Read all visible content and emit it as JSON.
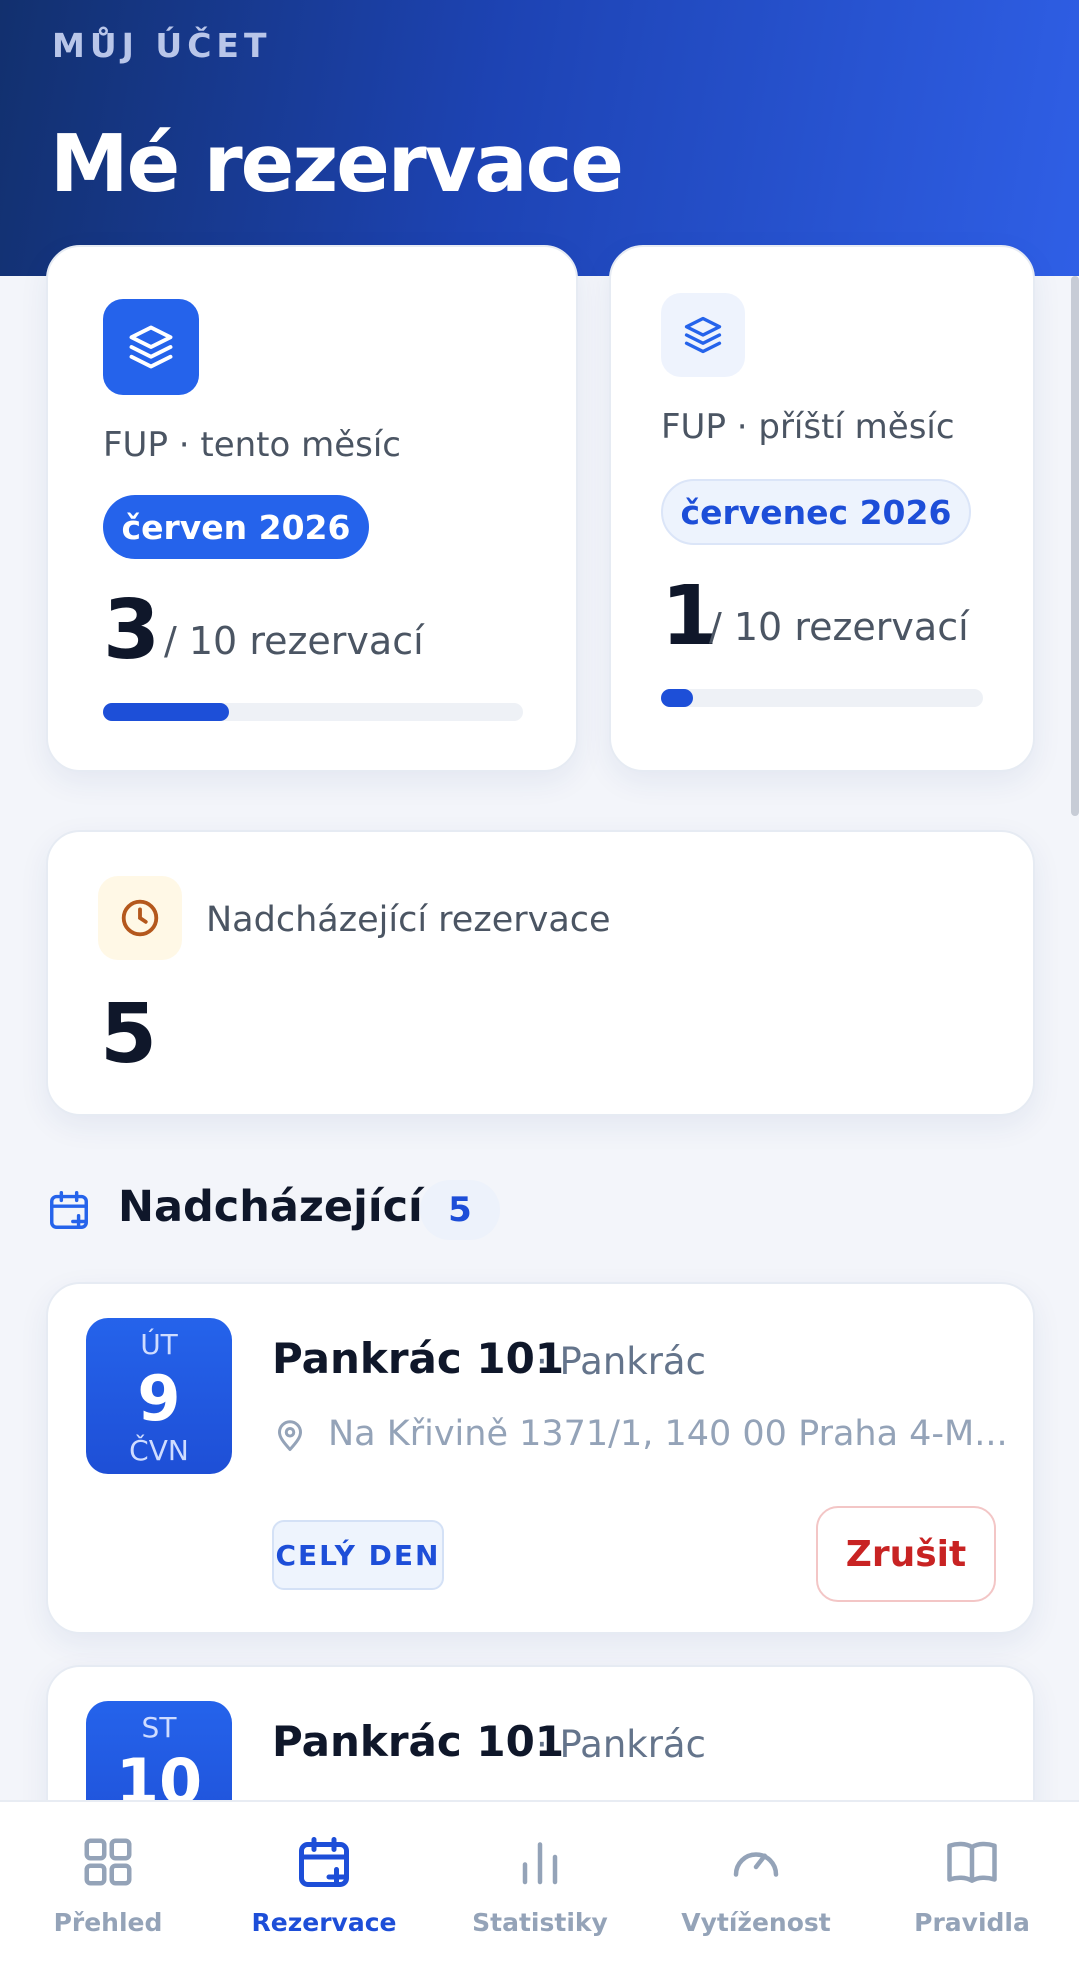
{
  "header": {
    "eyebrow": "MŮJ ÚČET",
    "title": "Mé rezervace"
  },
  "fup_current": {
    "label": "FUP · tento měsíc",
    "month": "červen 2026",
    "used": "3",
    "of_text": "/ 10 rezervací",
    "progress": 0.3,
    "icon": "layers-icon"
  },
  "fup_next": {
    "label": "FUP · příští měsíc",
    "month": "červenec 2026",
    "used": "1",
    "of_text": "/ 10 rezervací",
    "progress": 0.1,
    "icon": "layers-icon"
  },
  "upcoming_summary": {
    "label": "Nadcházející rezervace",
    "count": "5",
    "icon": "clock-icon"
  },
  "section": {
    "title": "Nadcházející",
    "count": "5",
    "icon": "calendar-plus-icon"
  },
  "reservations": [
    {
      "dow": "ÚT",
      "day": "9",
      "month": "ČVN",
      "name": "Pankrác 101",
      "area": "· Pankrác",
      "address": "Na Křivině 1371/1, 140 00 Praha 4-M...",
      "tag": "CELÝ DEN",
      "cancel": "Zrušit"
    },
    {
      "dow": "ST",
      "day": "10",
      "month": "",
      "name": "Pankrác 101",
      "area": "· Pankrác"
    }
  ],
  "nav": [
    {
      "label": "Přehled",
      "icon": "grid-icon",
      "active": false
    },
    {
      "label": "Rezervace",
      "icon": "calendar-plus-icon",
      "active": true
    },
    {
      "label": "Statistiky",
      "icon": "bar-chart-icon",
      "active": false
    },
    {
      "label": "Vytíženost",
      "icon": "gauge-icon",
      "active": false
    },
    {
      "label": "Pravidla",
      "icon": "book-icon",
      "active": false
    }
  ],
  "colors": {
    "accent": "#2563eb",
    "danger": "#c82323",
    "muted": "#94a3b8"
  }
}
